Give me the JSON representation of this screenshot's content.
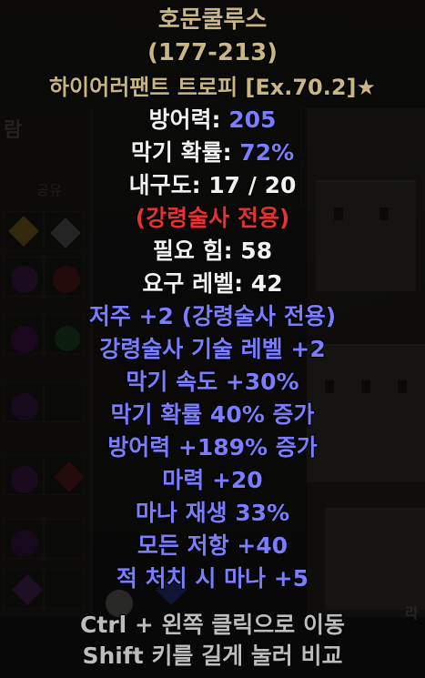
{
  "item": {
    "name": "호문쿨루스",
    "level_range": "(177-213)",
    "base_type": "하이어러팬트 트로피 [Ex.70.2]",
    "base_type_star": "★",
    "defense_label": "방어력: ",
    "defense_value": "205",
    "block_label": "막기 확률: ",
    "block_value": "72%",
    "durability": "내구도: 17 / 20",
    "class_restriction": "(강령술사 전용)",
    "requirements": {
      "strength": "필요 힘: 58",
      "level": "요구 레벨: 42"
    },
    "magic_properties": [
      "저주 +2 (강령술사 전용)",
      "강령술사 기술 레벨 +2",
      "막기 속도 +30%",
      "막기 확률 40% 증가",
      "방어력 +189% 증가",
      "마력 +20",
      "마나 재생 33%",
      "모든 저항 +40",
      "적 처치 시 마나 +5"
    ]
  },
  "hints": {
    "move": "Ctrl + 왼쪽 클릭으로 이동",
    "compare": "Shift 키를 길게 눌러 비교"
  },
  "background": {
    "inventory_column_label": "공유",
    "panel_fragment_left": "람",
    "panel_fragment_right": "라"
  },
  "colors": {
    "unique_name": "#c9b682",
    "magic_stat": "#7a7dff",
    "enhanced_value": "#7a7dff",
    "class_requirement": "#e43131",
    "normal_text": "#f1f1f1",
    "hint_text": "#bdbdbd"
  }
}
